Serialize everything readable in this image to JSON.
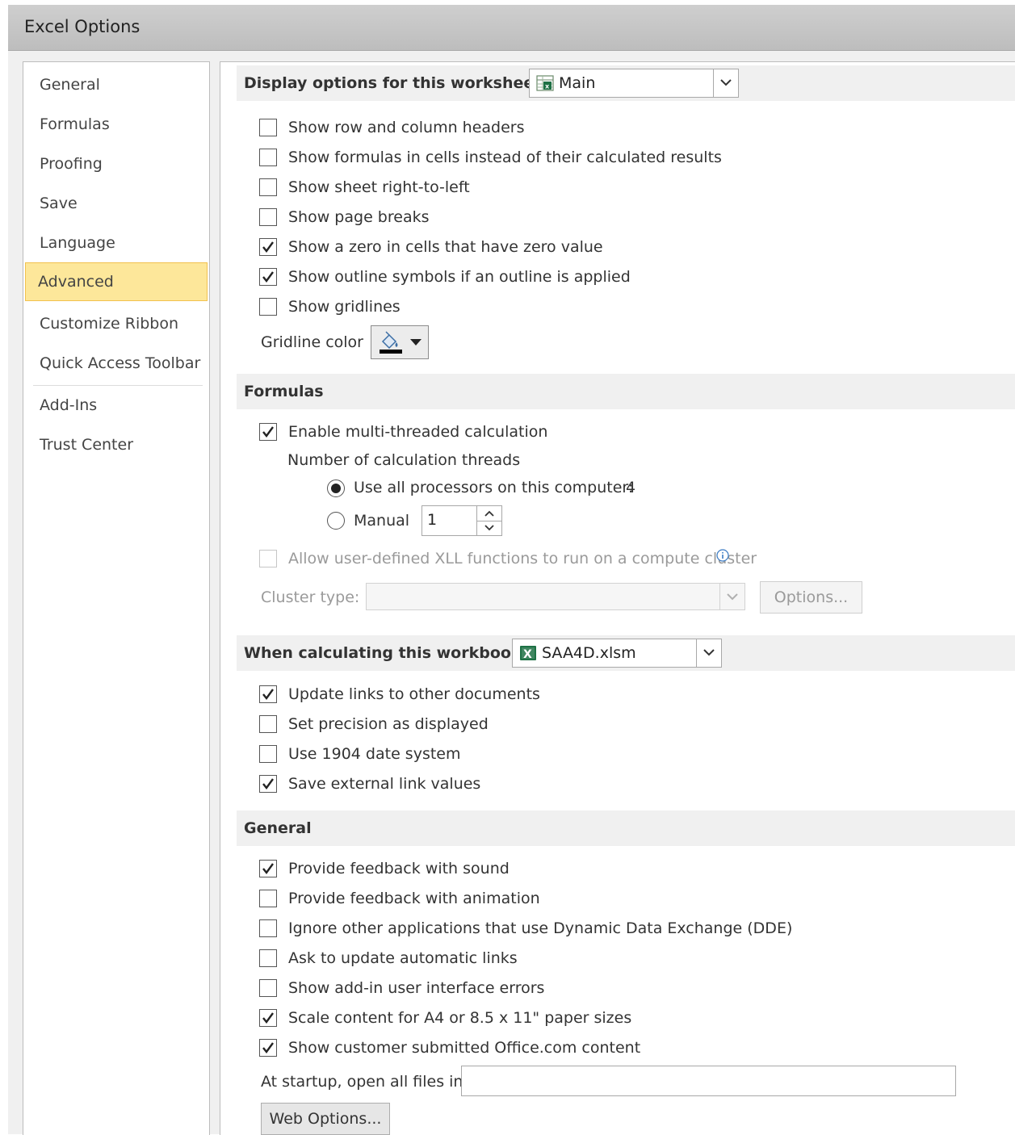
{
  "window": {
    "title": "Excel Options"
  },
  "sidebar": {
    "items": [
      {
        "label": "General"
      },
      {
        "label": "Formulas"
      },
      {
        "label": "Proofing"
      },
      {
        "label": "Save"
      },
      {
        "label": "Language"
      },
      {
        "label": "Advanced",
        "selected": true
      },
      {
        "label": "Customize Ribbon"
      },
      {
        "label": "Quick Access Toolbar"
      },
      {
        "label": "Add-Ins"
      },
      {
        "label": "Trust Center"
      }
    ]
  },
  "display_section": {
    "label": "Display options for this worksheet:",
    "worksheet_value": "Main",
    "options": [
      {
        "label": "Show row and column headers",
        "checked": false
      },
      {
        "label": "Show formulas in cells instead of their calculated results",
        "checked": false
      },
      {
        "label": "Show sheet right-to-left",
        "checked": false
      },
      {
        "label": "Show page breaks",
        "checked": false
      },
      {
        "label": "Show a zero in cells that have zero value",
        "checked": true
      },
      {
        "label": "Show outline symbols if an outline is applied",
        "checked": true
      },
      {
        "label": "Show gridlines",
        "checked": false
      }
    ],
    "gridline_color_label": "Gridline color",
    "gridline_color": "#000000"
  },
  "formulas_section": {
    "label": "Formulas",
    "multithread": {
      "label": "Enable multi-threaded calculation",
      "checked": true
    },
    "threads_label": "Number of calculation threads",
    "use_all": {
      "label": "Use all processors on this computer:",
      "value": "4",
      "selected": true
    },
    "manual": {
      "label": "Manual",
      "value": "1",
      "selected": false
    },
    "xll": {
      "label": "Allow user-defined XLL functions to run on a compute cluster",
      "checked": false,
      "disabled": true
    },
    "cluster_type_label": "Cluster type:",
    "options_button": "Options..."
  },
  "workbook_section": {
    "label": "When calculating this workbook:",
    "workbook_value": "SAA4D.xlsm",
    "options": [
      {
        "label": "Update links to other documents",
        "checked": true
      },
      {
        "label": "Set precision as displayed",
        "checked": false
      },
      {
        "label": "Use 1904 date system",
        "checked": false
      },
      {
        "label": "Save external link values",
        "checked": true
      }
    ]
  },
  "general_section": {
    "label": "General",
    "options": [
      {
        "label": "Provide feedback with sound",
        "checked": true
      },
      {
        "label": "Provide feedback with animation",
        "checked": false
      },
      {
        "label": "Ignore other applications that use Dynamic Data Exchange (DDE)",
        "checked": false
      },
      {
        "label": "Ask to update automatic links",
        "checked": false
      },
      {
        "label": "Show add-in user interface errors",
        "checked": false
      },
      {
        "label": "Scale content for A4 or 8.5 x 11\" paper sizes",
        "checked": true
      },
      {
        "label": "Show customer submitted Office.com content",
        "checked": true
      }
    ],
    "startup_label": "At startup, open all files in:",
    "startup_value": "",
    "web_options_button": "Web Options..."
  },
  "colors": {
    "selected_bg": "#fde79a",
    "selected_border": "#f2c14e",
    "excel_green": "#1e7145"
  }
}
